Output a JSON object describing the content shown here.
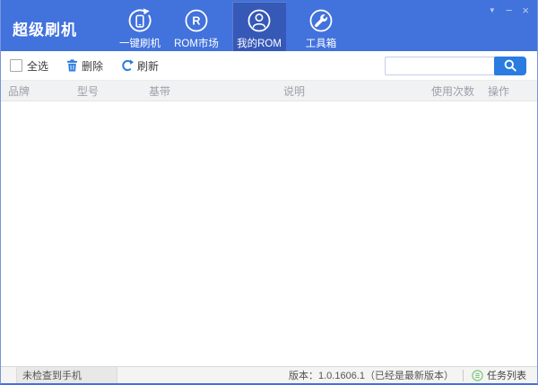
{
  "window": {
    "title": "超级刷机",
    "controls": {
      "menu_glyph": "▼",
      "minimize_glyph": "−",
      "close_glyph": "×"
    }
  },
  "nav": {
    "items": [
      {
        "label": "一键刷机",
        "icon": "phone-refresh-icon",
        "selected": false
      },
      {
        "label": "ROM市场",
        "icon": "rom-market-icon",
        "selected": false
      },
      {
        "label": "我的ROM",
        "icon": "user-rom-icon",
        "selected": true
      },
      {
        "label": "工具箱",
        "icon": "toolbox-wrench-icon",
        "selected": false
      }
    ]
  },
  "toolbar": {
    "select_all_label": "全选",
    "select_all_checked": false,
    "delete_label": "删除",
    "refresh_label": "刷新",
    "search": {
      "value": "",
      "placeholder": "",
      "button_icon": "search-icon"
    }
  },
  "table": {
    "columns": [
      "品牌",
      "型号",
      "基带",
      "说明",
      "使用次数",
      "操作"
    ],
    "rows": []
  },
  "statusbar": {
    "device_status": "未检查到手机",
    "version_text": "版本：1.0.1606.1（已经是最新版本）",
    "task_list_label": "任务列表",
    "task_list_icon": "task-list-icon"
  },
  "colors": {
    "titlebar_blue": "#4272dc",
    "selected_tab_blue": "#3659b8",
    "accent_blue": "#2a7ce0",
    "task_green": "#7cc87f",
    "header_bg": "#f1f2f4",
    "statusbar_bg": "#f4f4f2"
  }
}
